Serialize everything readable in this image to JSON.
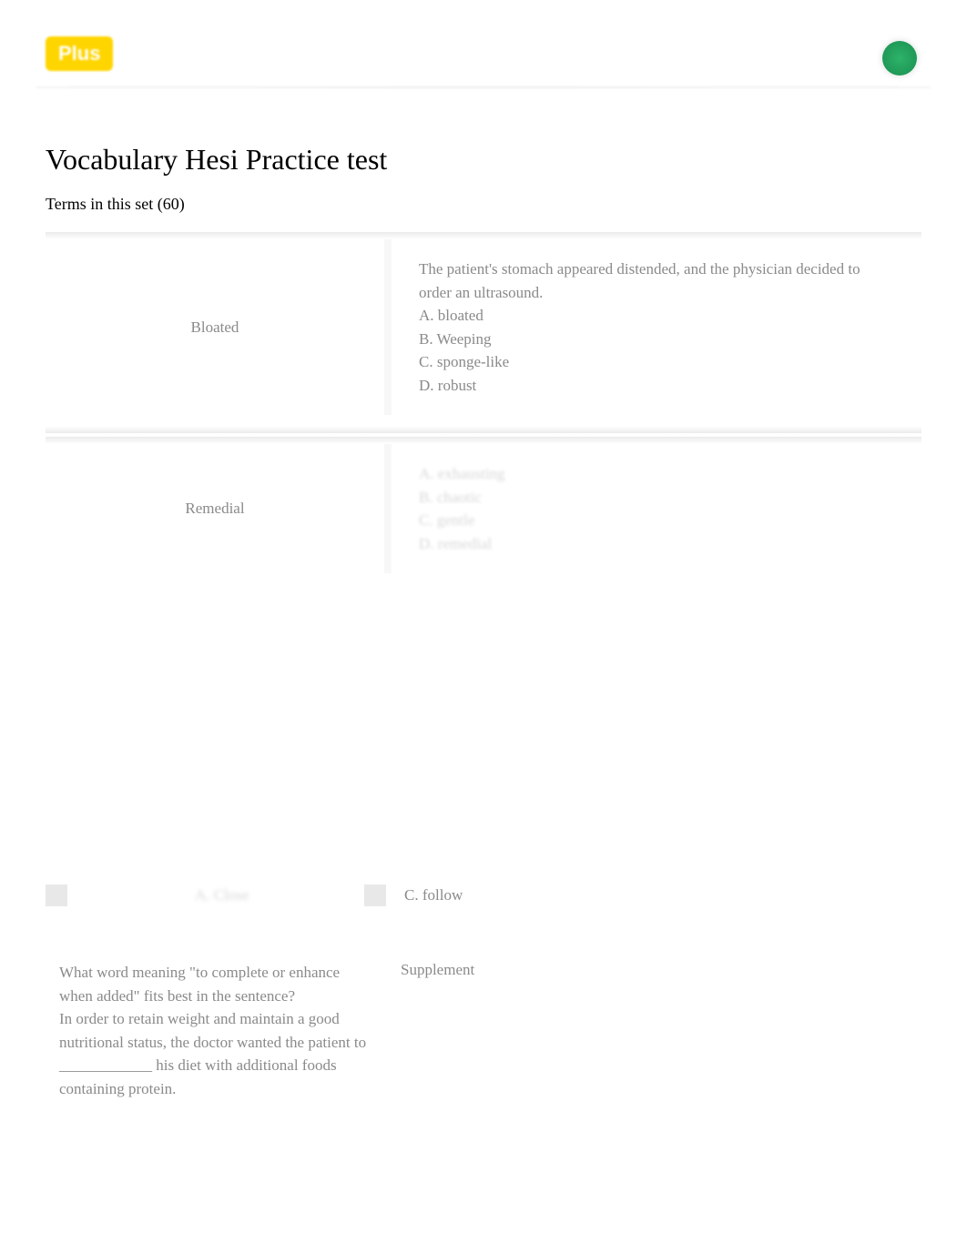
{
  "header": {
    "logo_text": "Plus"
  },
  "page": {
    "title": "Vocabulary Hesi Practice test",
    "subtitle": "Terms in this set (60)"
  },
  "cards": [
    {
      "term": "Bloated",
      "definition": {
        "intro": "The patient's stomach appeared distended, and the physician decided to order an ultrasound.",
        "options": [
          "A. bloated",
          "B. Weeping",
          "C. sponge-like",
          "D. robust"
        ]
      }
    },
    {
      "term": "Remedial",
      "definition": {
        "intro": "",
        "options": [
          "A. exhausting",
          "B. chaotic",
          "C. gentle",
          "D. remedial"
        ]
      }
    }
  ],
  "follow": {
    "left_hidden": "A. Close",
    "right": "C. follow"
  },
  "supplement": {
    "question_line1": "What word meaning \"to complete or enhance when added\" fits best in the sentence?",
    "question_line2": "In order to retain weight and maintain a good nutritional status, the doctor wanted the patient to ____________ his diet with additional foods containing protein.",
    "answer": "Supplement"
  }
}
